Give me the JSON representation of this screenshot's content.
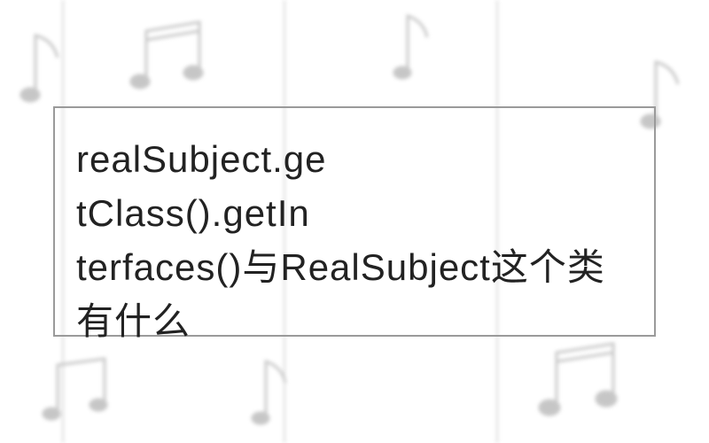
{
  "content": {
    "line1": "realSubject.ge",
    "line2": "tClass().getIn",
    "line3": "terfaces()与RealSubject这个类有什么"
  },
  "icons": {
    "eighth_note": "eighth-note-icon",
    "beamed_notes": "beamed-notes-icon"
  }
}
